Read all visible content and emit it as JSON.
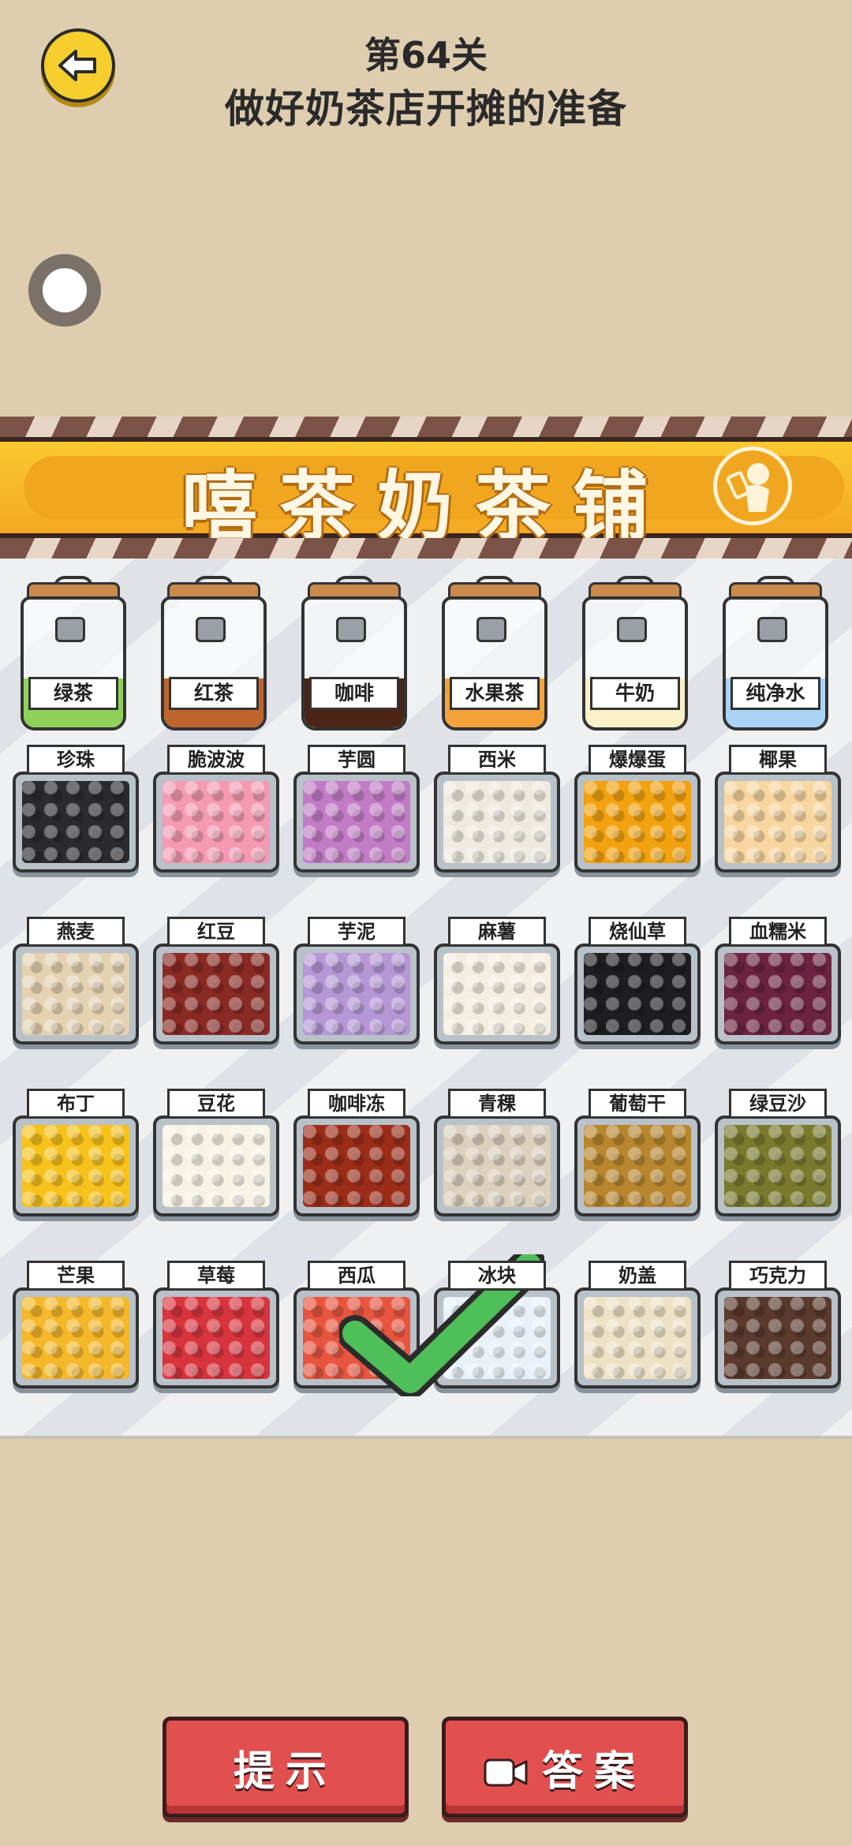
{
  "header": {
    "level": "第64关",
    "task": "做好奶茶店开摊的准备"
  },
  "shop": {
    "name": "嘻茶奶茶铺"
  },
  "jars": [
    {
      "label": "绿茶",
      "color": "#8fd25a"
    },
    {
      "label": "红茶",
      "color": "#c0642e"
    },
    {
      "label": "咖啡",
      "color": "#4a2414"
    },
    {
      "label": "水果茶",
      "color": "#f5a23a"
    },
    {
      "label": "牛奶",
      "color": "#fbf1c9"
    },
    {
      "label": "纯净水",
      "color": "#a9d4f5"
    }
  ],
  "trays": [
    {
      "label": "珍珠",
      "color": "#2b2b2e"
    },
    {
      "label": "脆波波",
      "color": "#f49ab3"
    },
    {
      "label": "芋圆",
      "color": "#c27cc6"
    },
    {
      "label": "西米",
      "color": "#eeeae0"
    },
    {
      "label": "爆爆蛋",
      "color": "#f2a20f"
    },
    {
      "label": "椰果",
      "color": "#f7d6a0"
    },
    {
      "label": "燕麦",
      "color": "#e4d2b2"
    },
    {
      "label": "红豆",
      "color": "#8a2a24"
    },
    {
      "label": "芋泥",
      "color": "#b597d6"
    },
    {
      "label": "麻薯",
      "color": "#f4eee2"
    },
    {
      "label": "烧仙草",
      "color": "#1e1e22"
    },
    {
      "label": "血糯米",
      "color": "#6b2340"
    },
    {
      "label": "布丁",
      "color": "#f7c21c"
    },
    {
      "label": "豆花",
      "color": "#f7f2e3"
    },
    {
      "label": "咖啡冻",
      "color": "#9b2d18"
    },
    {
      "label": "青稞",
      "color": "#dcd0be"
    },
    {
      "label": "葡萄干",
      "color": "#b7862e"
    },
    {
      "label": "绿豆沙",
      "color": "#7a7a2e"
    },
    {
      "label": "芒果",
      "color": "#f5b82a"
    },
    {
      "label": "草莓",
      "color": "#d8343e"
    },
    {
      "label": "西瓜",
      "color": "#e8553f"
    },
    {
      "label": "冰块",
      "color": "#e9f1f8"
    },
    {
      "label": "奶盖",
      "color": "#eee2c6"
    },
    {
      "label": "巧克力",
      "color": "#5a3a2c"
    }
  ],
  "buttons": {
    "hint": "提示",
    "answer": "答案"
  }
}
